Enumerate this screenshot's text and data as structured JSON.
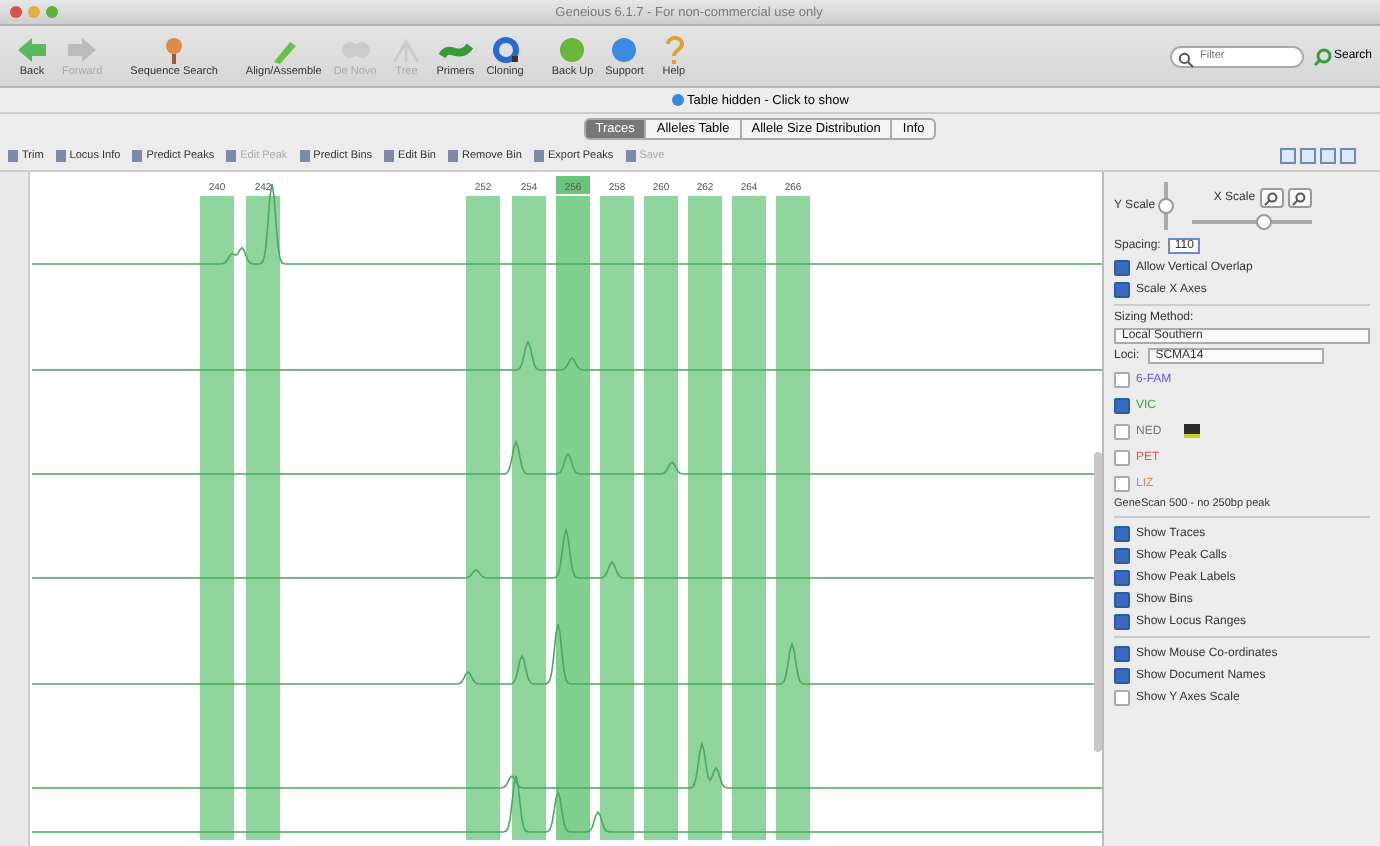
{
  "window": {
    "title": "Geneious 6.1.7 - For non-commercial use only"
  },
  "toolbar": [
    {
      "label": "Back",
      "disabled": false
    },
    {
      "label": "Forward",
      "disabled": true
    },
    {
      "label": "Sequence Search",
      "disabled": false
    },
    {
      "label": "Align/Assemble",
      "disabled": false
    },
    {
      "label": "De Novo",
      "disabled": true
    },
    {
      "label": "Tree",
      "disabled": true
    },
    {
      "label": "Primers",
      "disabled": false
    },
    {
      "label": "Cloning",
      "disabled": false
    },
    {
      "label": "Back Up",
      "disabled": false
    },
    {
      "label": "Support",
      "disabled": false
    },
    {
      "label": "Help",
      "disabled": false
    }
  ],
  "search": {
    "placeholder": "Filter",
    "button": "Search"
  },
  "table_notice": "Table hidden - Click to show",
  "tabs": [
    {
      "label": "Traces",
      "selected": true
    },
    {
      "label": "Alleles Table",
      "selected": false
    },
    {
      "label": "Allele Size Distribution",
      "selected": false
    },
    {
      "label": "Info",
      "selected": false
    }
  ],
  "actions": [
    {
      "label": "Trim",
      "disabled": false
    },
    {
      "label": "Locus Info",
      "disabled": false
    },
    {
      "label": "Predict Peaks",
      "disabled": false
    },
    {
      "label": "Edit Peak",
      "disabled": true
    },
    {
      "label": "Predict Bins",
      "disabled": false
    },
    {
      "label": "Edit Bin",
      "disabled": false
    },
    {
      "label": "Remove Bin",
      "disabled": false
    },
    {
      "label": "Export Peaks",
      "disabled": false
    },
    {
      "label": "Save",
      "disabled": true
    }
  ],
  "bins": [
    {
      "label": "240",
      "selected": false
    },
    {
      "label": "242",
      "selected": false
    },
    {
      "label": "252",
      "selected": false
    },
    {
      "label": "254",
      "selected": false
    },
    {
      "label": "256",
      "selected": true
    },
    {
      "label": "258",
      "selected": false
    },
    {
      "label": "260",
      "selected": false
    },
    {
      "label": "262",
      "selected": false
    },
    {
      "label": "264",
      "selected": false
    },
    {
      "label": "266",
      "selected": false
    }
  ],
  "panel": {
    "y_scale": {
      "label": "Y Scale",
      "level": 0.5
    },
    "x_scale": {
      "label": "X Scale",
      "level": 0.6
    },
    "spacing": {
      "label": "Spacing:",
      "value": "110"
    },
    "options_top": [
      {
        "label": "Allow Vertical Overlap",
        "checked": true
      },
      {
        "label": "Scale X Axes",
        "checked": true
      }
    ],
    "sizing_method": {
      "label": "Sizing Method:",
      "value": "Local Southern"
    },
    "loci": {
      "label": "Loci:",
      "value": "SCMA14"
    },
    "dyes": [
      {
        "label": "6-FAM",
        "checked": false,
        "color": "#5a5ae0"
      },
      {
        "label": "VIC",
        "checked": true,
        "color": "#3aa03a"
      },
      {
        "label": "NED",
        "checked": false,
        "color": "#777777"
      },
      {
        "label": "PET",
        "checked": false,
        "color": "#e05050"
      },
      {
        "label": "LIZ",
        "checked": false,
        "color": "#e08060"
      }
    ],
    "size_standard": "GeneScan 500 - no 250bp peak",
    "options_show": [
      {
        "label": "Show Traces",
        "checked": true
      },
      {
        "label": "Show Peak Calls",
        "checked": true
      },
      {
        "label": "Show Peak Labels",
        "checked": true
      },
      {
        "label": "Show Bins",
        "checked": true
      },
      {
        "label": "Show Locus Ranges",
        "checked": true
      }
    ],
    "options_doc": [
      {
        "label": "Show Mouse Co-ordinates",
        "checked": true
      },
      {
        "label": "Show Document Names",
        "checked": true
      },
      {
        "label": "Show Y Axes Scale",
        "checked": false
      }
    ]
  }
}
